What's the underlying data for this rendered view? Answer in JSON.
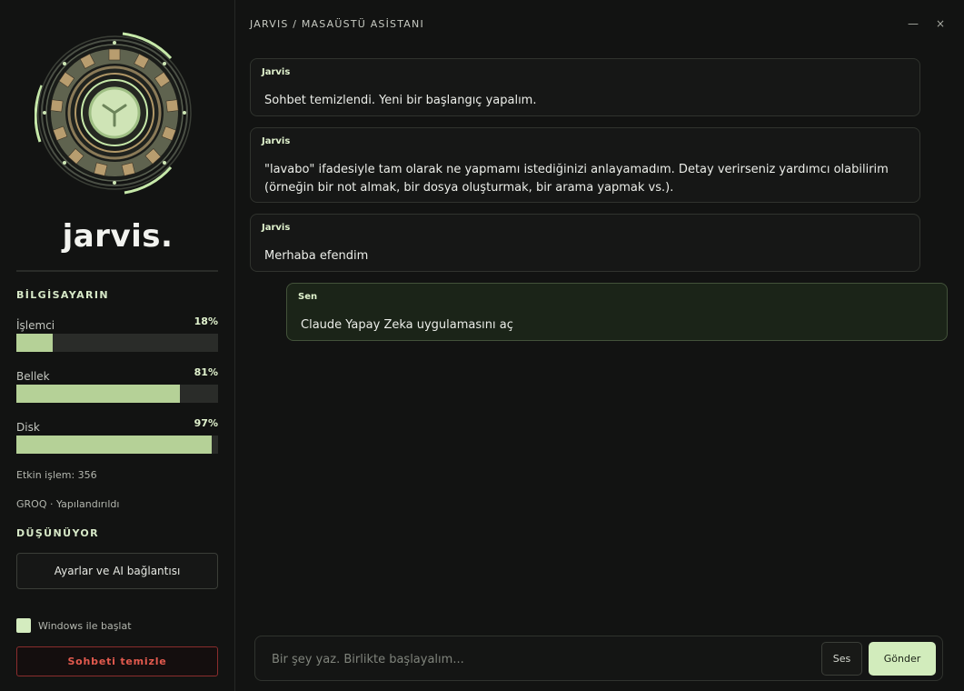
{
  "sidebar": {
    "brand": "jarvis.",
    "system_title": "BİLGİSAYARIN",
    "metrics": [
      {
        "label": "İşlemci",
        "value": "18%",
        "fraction": 0.18
      },
      {
        "label": "Bellek",
        "value": "81%",
        "fraction": 0.81
      },
      {
        "label": "Disk",
        "value": "97%",
        "fraction": 0.97
      }
    ],
    "active_processes": "Etkin işlem: 356",
    "provider_status": "GROQ · Yapılandırıldı",
    "state_title": "DÜŞÜNÜYOR",
    "settings_button": "Ayarlar ve AI bağlantısı",
    "startup_label": "Windows ile başlat",
    "startup_checked": true,
    "clear_button": "Sohbeti temizle"
  },
  "header": {
    "breadcrumb": "JARVIS / MASAÜSTÜ ASİSTANI",
    "minimize_icon": "minimize-icon",
    "close_icon": "close-icon"
  },
  "messages": [
    {
      "author": "Jarvis",
      "text": "Sohbet temizlendi. Yeni bir başlangıç yapalım."
    },
    {
      "author": "Jarvis",
      "text": "\"lavabo\" ifadesiyle tam olarak ne yapmamı istediğinizi anlayamadım. Detay verirseniz yardımcı olabilirim (örneğin bir not almak, bir dosya oluşturmak, bir arama yapmak vs.)."
    },
    {
      "author": "Jarvis",
      "text": "Merhaba efendim"
    },
    {
      "author": "Sen",
      "text": "Claude Yapay Zeka uygulamasını aç"
    }
  ],
  "composer": {
    "placeholder": "Bir şey yaz. Birlikte başlayalım...",
    "voice_button": "Ses",
    "send_button": "Gönder"
  },
  "colors": {
    "accent": "#d2ecbc",
    "bar_fill": "#b5d197",
    "danger": "#e25a4e",
    "user_bubble": "#1b2418"
  }
}
